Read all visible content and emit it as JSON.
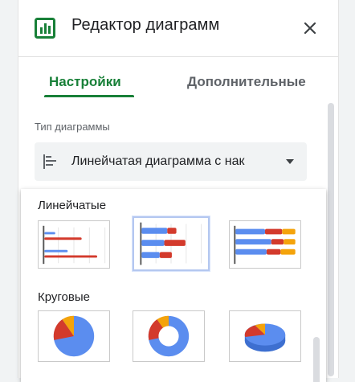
{
  "header": {
    "title": "Редактор диаграмм",
    "icon": "bar-chart-icon",
    "close_icon": "close-icon"
  },
  "tabs": [
    {
      "label": "Настройки",
      "active": true
    },
    {
      "label": "Дополнительные",
      "active": false
    }
  ],
  "chart_type": {
    "label": "Тип диаграммы",
    "selected": "Линейчатая диаграмма с нак"
  },
  "dropdown": {
    "groups": [
      {
        "title": "Линейчатые",
        "items": [
          "bar-chart",
          "stacked-bar-chart",
          "percent-stacked-bar-chart"
        ],
        "selected_index": 1
      },
      {
        "title": "Круговые",
        "items": [
          "pie-chart",
          "donut-chart",
          "3d-pie-chart"
        ]
      }
    ]
  },
  "colors": {
    "accent": "#188038",
    "blue": "#5b8def",
    "red": "#d33a2c",
    "orange": "#f4a30b",
    "text": "#202124",
    "muted": "#5f6368"
  }
}
